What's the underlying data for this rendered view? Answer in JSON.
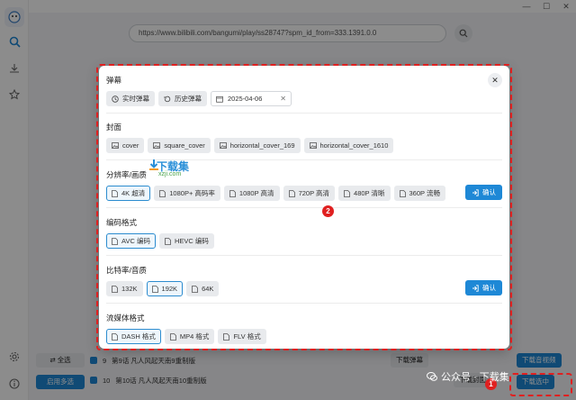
{
  "window": {
    "minimize": "—",
    "maximize": "☐",
    "close": "✕"
  },
  "url": "https://www.bilibili.com/bangumi/play/ss28747?spm_id_from=333.1391.0.0",
  "background": {
    "select_all": "全选",
    "enable_multi": "启用多选",
    "rows": [
      {
        "num": "9",
        "title": "第9话 凡人风起天南9重制版",
        "action": "下载弹幕"
      },
      {
        "num": "10",
        "title": "第10话 凡人风起天南10重制版",
        "action": "下载封面"
      }
    ],
    "download_audio_video": "下载音视频",
    "download_selected": "下载选中"
  },
  "dialog": {
    "danmaku": {
      "title": "弹幕",
      "realtime": "实时弹幕",
      "history": "历史弹幕",
      "date": "2025-04-06"
    },
    "cover": {
      "title": "封面",
      "options": [
        "cover",
        "square_cover",
        "horizontal_cover_169",
        "horizontal_cover_1610"
      ]
    },
    "resolution": {
      "title": "分辨率/画质",
      "options": [
        "4K 超清",
        "1080P+ 高码率",
        "1080P 高清",
        "720P 高清",
        "480P 清晰",
        "360P 流畅"
      ],
      "selected": 0,
      "confirm": "确认"
    },
    "codec": {
      "title": "编码格式",
      "options": [
        "AVC 编码",
        "HEVC 编码"
      ],
      "selected": 0
    },
    "bitrate": {
      "title": "比特率/音质",
      "options": [
        "132K",
        "192K",
        "64K"
      ],
      "selected": 1,
      "confirm": "确认"
    },
    "stream": {
      "title": "流媒体格式",
      "options": [
        "DASH 格式",
        "MP4 格式",
        "FLV 格式"
      ],
      "selected": 0
    }
  },
  "annotations": {
    "badge1": "1",
    "badge2": "2"
  },
  "watermark": {
    "title": "下载集",
    "sub": "xzji.com"
  },
  "bottom_watermark": "公众号 · 下载集",
  "colors": {
    "accent": "#1e88d6",
    "annotation": "#e02020"
  }
}
